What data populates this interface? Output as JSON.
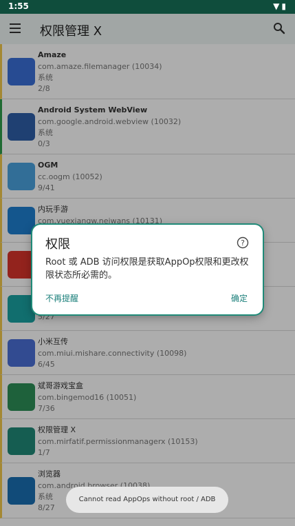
{
  "status_bar": {
    "time": "1:55"
  },
  "app_bar": {
    "title": "权限管理 X"
  },
  "apps": [
    {
      "name": "Amaze",
      "package": "com.amaze.filemanager (10034)",
      "type": "系统",
      "count": "2/8",
      "color": "#3a6fd8"
    },
    {
      "name": "Android System WebView",
      "package": "com.google.android.webview (10032)",
      "type": "系统",
      "count": "0/3",
      "color": "#2f5fa8"
    },
    {
      "name": "OGM",
      "package": "cc.oogm (10052)",
      "type": "",
      "count": "9/41",
      "color": "#4aa3df"
    },
    {
      "name": "内玩手游",
      "package": "com.yuexiangw.neiwans (10131)",
      "type": "",
      "count": "",
      "color": "#1e7fd0"
    },
    {
      "name": "",
      "package": "",
      "type": "",
      "count": "",
      "color": "#d9342b"
    },
    {
      "name": "",
      "package": "",
      "type": "",
      "count": "5/27",
      "color": "#1aa3a3"
    },
    {
      "name": "小米互传",
      "package": "com.miui.mishare.connectivity (10098)",
      "type": "",
      "count": "6/45",
      "color": "#4b6fd6"
    },
    {
      "name": "斌哥游戏宝盒",
      "package": "com.bingemod16 (10051)",
      "type": "",
      "count": "7/36",
      "color": "#2d8f57"
    },
    {
      "name": "权限管理 X",
      "package": "com.mirfatif.permissionmanagerx (10153)",
      "type": "",
      "count": "1/7",
      "color": "#1f8a78"
    },
    {
      "name": "浏览器",
      "package": "com.android.browser (10038)",
      "type": "系统",
      "count": "8/27",
      "color": "#1a6fb3"
    }
  ],
  "dialog": {
    "title": "权限",
    "message": "Root 或 ADB 访问权限是获取AppOp权限和更改权限状态所必需的。",
    "neutral_label": "不再提醒",
    "positive_label": "确定"
  },
  "toast": {
    "text": "Cannot read AppOps without root / ADB"
  }
}
